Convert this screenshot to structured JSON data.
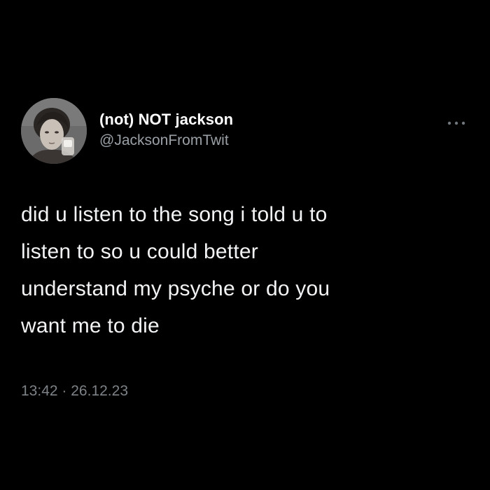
{
  "tweet": {
    "display_name": "(not) NOT jackson",
    "handle": "@JacksonFromTwit",
    "text_lines": [
      "did u listen to the song i told u to",
      "listen to so u could better",
      "understand my psyche or do you",
      "want me to die"
    ],
    "time": "13:42",
    "separator": "·",
    "date": "26.12.23",
    "more_icon": "more-horizontal-icon"
  },
  "colors": {
    "background": "#000000",
    "text": "#f2f3f5",
    "secondary": "#9aa0a6"
  }
}
